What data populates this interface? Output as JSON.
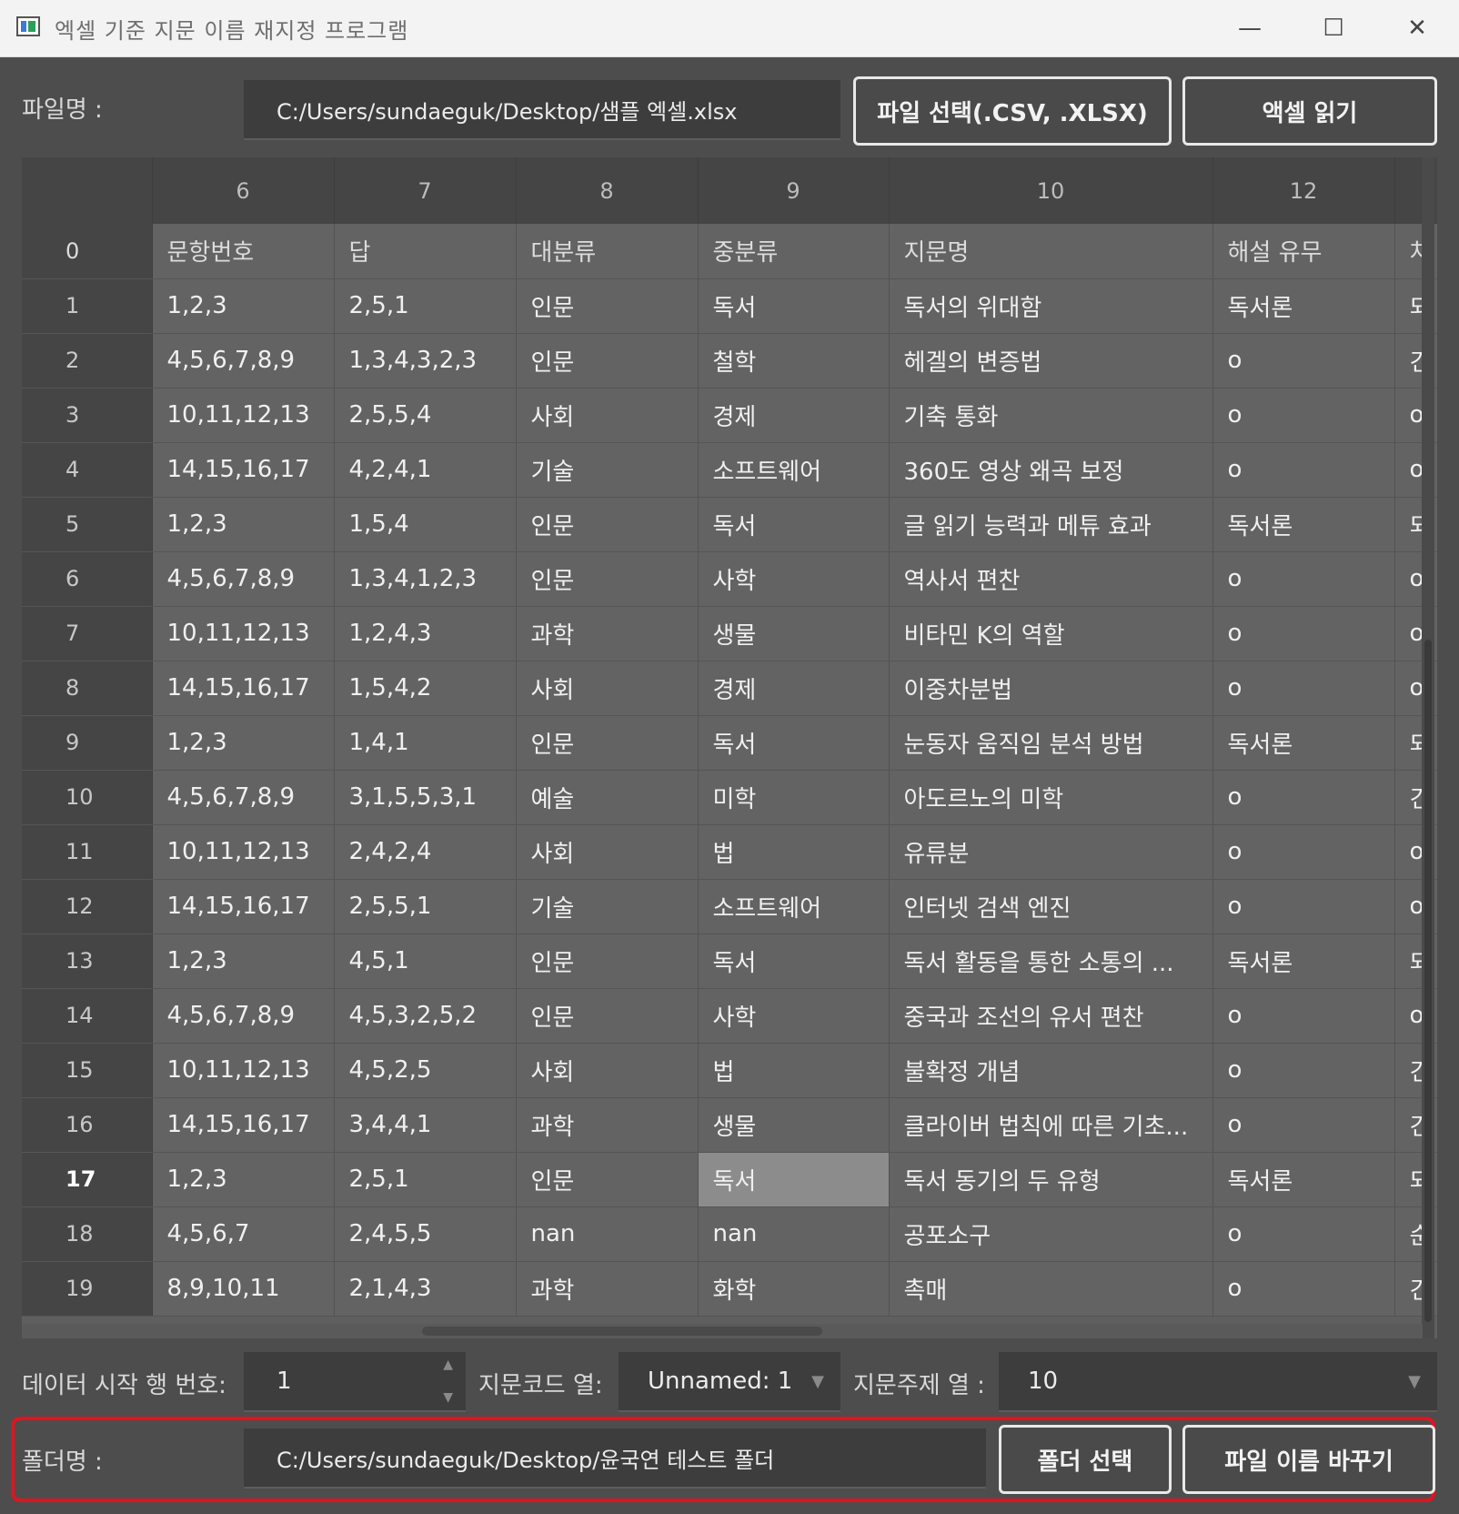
{
  "window": {
    "title": "엑셀 기준 지문 이름 재지정 프로그램",
    "controls": {
      "minimize": "—",
      "maximize": "☐",
      "close": "✕"
    }
  },
  "file": {
    "label": "파일명 :",
    "path": "C:/Users/sundaeguk/Desktop/샘플 엑셀.xlsx",
    "select_button": "파일 선택(.CSV, .XLSX)",
    "read_button": "액셀 읽기"
  },
  "table": {
    "columns": [
      "",
      "6",
      "7",
      "8",
      "9",
      "10",
      "12",
      ""
    ],
    "rows": [
      [
        "0",
        "문항번호",
        "답",
        "대분류",
        "중분류",
        "지문명",
        "해설 유무",
        "처"
      ],
      [
        "1",
        "1,2,3",
        "2,5,1",
        "인문",
        "독서",
        "독서의 위대함",
        "독서론",
        "되"
      ],
      [
        "2",
        "4,5,6,7,8,9",
        "1,3,4,3,2,3",
        "인문",
        "철학",
        "헤겔의 변증법",
        "o",
        "긴"
      ],
      [
        "3",
        "10,11,12,13",
        "2,5,5,4",
        "사회",
        "경제",
        "기축 통화",
        "o",
        "o"
      ],
      [
        "4",
        "14,15,16,17",
        "4,2,4,1",
        "기술",
        "소프트웨어",
        "360도 영상 왜곡 보정",
        "o",
        "o"
      ],
      [
        "5",
        "1,2,3",
        "1,5,4",
        "인문",
        "독서",
        "글 읽기 능력과 메튜 효과",
        "독서론",
        "되"
      ],
      [
        "6",
        "4,5,6,7,8,9",
        "1,3,4,1,2,3",
        "인문",
        "사학",
        "역사서 편찬",
        "o",
        "o"
      ],
      [
        "7",
        "10,11,12,13",
        "1,2,4,3",
        "과학",
        "생물",
        "비타민 K의 역할",
        "o",
        "o"
      ],
      [
        "8",
        "14,15,16,17",
        "1,5,4,2",
        "사회",
        "경제",
        "이중차분법",
        "o",
        "o"
      ],
      [
        "9",
        "1,2,3",
        "1,4,1",
        "인문",
        "독서",
        "눈동자 움직임 분석 방법",
        "독서론",
        "되"
      ],
      [
        "10",
        "4,5,6,7,8,9",
        "3,1,5,5,3,1",
        "예술",
        "미학",
        "아도르노의 미학",
        "o",
        "긴"
      ],
      [
        "11",
        "10,11,12,13",
        "2,4,2,4",
        "사회",
        "법",
        "유류분",
        "o",
        "o"
      ],
      [
        "12",
        "14,15,16,17",
        "2,5,5,1",
        "기술",
        "소프트웨어",
        "인터넷 검색 엔진",
        "o",
        "o"
      ],
      [
        "13",
        "1,2,3",
        "4,5,1",
        "인문",
        "독서",
        "독서 활동을 통한 소통의 ...",
        "독서론",
        "되"
      ],
      [
        "14",
        "4,5,6,7,8,9",
        "4,5,3,2,5,2",
        "인문",
        "사학",
        "중국과 조선의 유서 편찬",
        "o",
        "o"
      ],
      [
        "15",
        "10,11,12,13",
        "4,5,2,5",
        "사회",
        "법",
        "불확정 개념",
        "o",
        "긴"
      ],
      [
        "16",
        "14,15,16,17",
        "3,4,4,1",
        "과학",
        "생물",
        "클라이버 법칙에 따른 기초...",
        "o",
        "긴"
      ],
      [
        "17",
        "1,2,3",
        "2,5,1",
        "인문",
        "독서",
        "독서 동기의 두 유형",
        "독서론",
        "되"
      ],
      [
        "18",
        "4,5,6,7",
        "2,4,5,5",
        "nan",
        "nan",
        "공포소구",
        "o",
        "순"
      ],
      [
        "19",
        "8,9,10,11",
        "2,1,4,3",
        "과학",
        "화학",
        "촉매",
        "o",
        "긴"
      ]
    ],
    "selected_cell": {
      "row": 17,
      "column": "9"
    }
  },
  "settings": {
    "start_row_label": "데이터 시작 행 번호:",
    "start_row_value": "1",
    "code_col_label": "지문코드 열:",
    "code_col_value": "Unnamed: 1",
    "topic_col_label": "지문주제 열 :",
    "topic_col_value": "10"
  },
  "folder": {
    "label": "폴더명 :",
    "path": "C:/Users/sundaeguk/Desktop/윤국연 테스트 폴더",
    "select_button": "폴더 선택",
    "rename_button": "파일 이름 바꾸기"
  },
  "colors": {
    "highlight_border": "#e0141e",
    "background": "#4d4d4d",
    "selected_cell": "#8c8c8c"
  }
}
